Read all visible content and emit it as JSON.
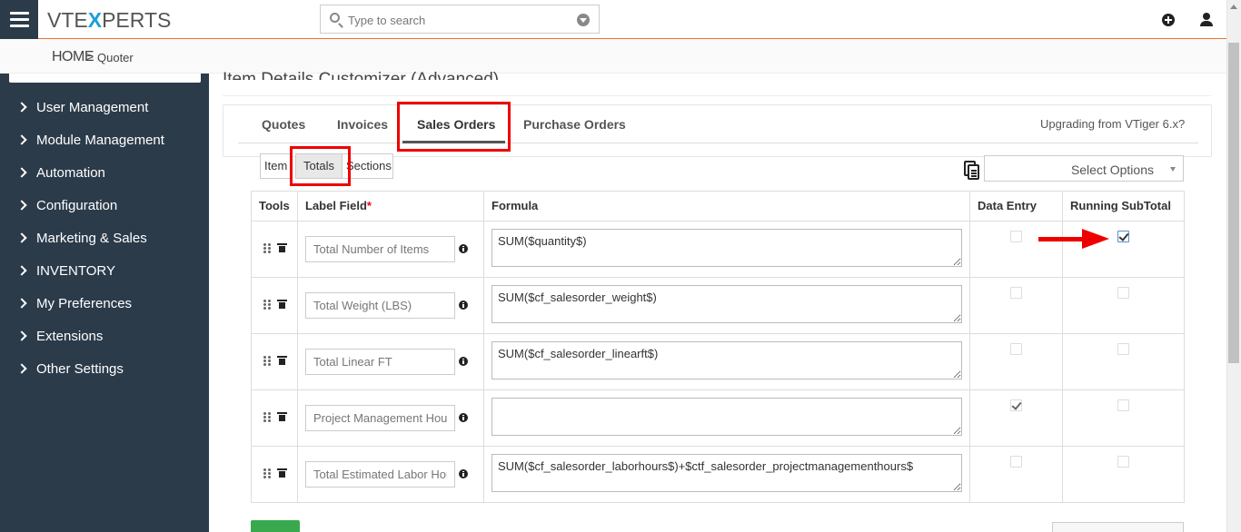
{
  "topbar": {
    "logo_pre": "VTE",
    "logo_x": "X",
    "logo_post": "PERTS",
    "search_placeholder": "Type to search"
  },
  "breadcrumb": {
    "home": "HOME",
    "separator": ">",
    "current": "Quoter"
  },
  "sidebar": {
    "items": [
      {
        "label": "User Management"
      },
      {
        "label": "Module Management"
      },
      {
        "label": "Automation"
      },
      {
        "label": "Configuration"
      },
      {
        "label": "Marketing & Sales"
      },
      {
        "label": "INVENTORY"
      },
      {
        "label": "My Preferences"
      },
      {
        "label": "Extensions"
      },
      {
        "label": "Other Settings"
      }
    ]
  },
  "main": {
    "page_title": "Item Details Customizer (Advanced)",
    "tabs": [
      {
        "label": "Quotes"
      },
      {
        "label": "Invoices"
      },
      {
        "label": "Sales Orders"
      },
      {
        "label": "Purchase Orders"
      }
    ],
    "active_tab": "Sales Orders",
    "upgrade_link": "Upgrading from VTiger 6.x?",
    "subtabs": [
      {
        "label": "Item"
      },
      {
        "label": "Totals"
      },
      {
        "label": "Sections"
      }
    ],
    "active_subtab": "Totals",
    "select_options": "Select Options",
    "columns": {
      "tools": "Tools",
      "label_field": "Label Field",
      "required_mark": "*",
      "formula": "Formula",
      "data_entry": "Data Entry",
      "running_subtotal": "Running SubTotal"
    },
    "rows": [
      {
        "label": "Total Number of Items",
        "formula": "SUM($quantity$)",
        "data_entry": false,
        "running_subtotal": true
      },
      {
        "label": "Total Weight (LBS)",
        "formula": "SUM($cf_salesorder_weight$)",
        "data_entry": false,
        "running_subtotal": false
      },
      {
        "label": "Total Linear FT",
        "formula": "SUM($cf_salesorder_linearft$)",
        "data_entry": false,
        "running_subtotal": false
      },
      {
        "label": "Project Management Hours",
        "formula": "",
        "data_entry": true,
        "running_subtotal": false
      },
      {
        "label": "Total Estimated Labor Hours",
        "formula": "SUM($cf_salesorder_laborhours$)+$ctf_salesorder_projectmanagementhours$",
        "data_entry": false,
        "running_subtotal": false
      }
    ]
  },
  "colors": {
    "accent_orange": "#e8743b",
    "sidebar_bg": "#2c3b4a",
    "highlight_red": "#ee0000",
    "logo_blue": "#1c9fd8"
  }
}
